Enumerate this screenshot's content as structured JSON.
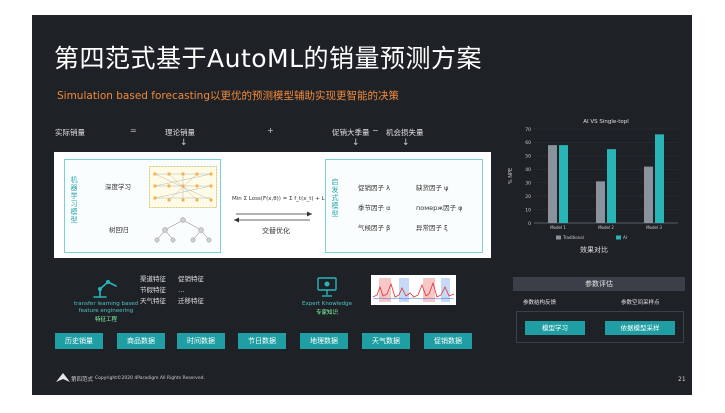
{
  "title": "第四范式基于AutoML的销量预测方案",
  "subtitle": "Simulation based forecasting以更优的预测模型辅助实现更智能的决策",
  "formula_row": {
    "actual": "实际销量",
    "eq": "=",
    "theoretical": "理论销量",
    "plus": "+",
    "promo": "促销大季量",
    "minus": "−",
    "lost": "机会损失量"
  },
  "left_box": {
    "label": "机器学习模型",
    "item1": "深度学习",
    "item2": "树回归"
  },
  "middle": {
    "formula": "Min Σ Loss(F(x,θ)) = Σ f_t(x_t) + L(θ)",
    "caption": "交替优化"
  },
  "right_box": {
    "label": "启发式模型",
    "factors": [
      [
        "促销因子 λ",
        "缺货因子 ψ"
      ],
      [
        "季节因子 α",
        "померж因子 φ"
      ],
      [
        "气候因子 β",
        "异常因子 ξ"
      ]
    ]
  },
  "bottom_left": {
    "caption_en1": "transfer learning based",
    "caption_en2": "feature engineering",
    "caption_cn": "特征工程",
    "features_col1": [
      "渠道特征",
      "节假特征",
      "天气特征"
    ],
    "features_col2": [
      "促销特征",
      "…",
      "迁移特征"
    ]
  },
  "expert": {
    "caption_en": "Expert Knowledge",
    "caption_cn": "专家知识"
  },
  "data_sources": [
    "历史销量",
    "商品数据",
    "时间数据",
    "节日数据",
    "地理数据",
    "天气数据",
    "促销数据"
  ],
  "right_chart": {
    "caption": "效果对比"
  },
  "chart_data": {
    "type": "bar",
    "title": "AI VS Single-topl",
    "categories": [
      "Model 1",
      "Model 2",
      "Model 3"
    ],
    "series": [
      {
        "name": "Traditional",
        "values": [
          58,
          31,
          42
        ]
      },
      {
        "name": "AI",
        "values": [
          58,
          55,
          66
        ]
      }
    ],
    "ylabel": "% NPE",
    "ylim": [
      0,
      70
    ],
    "yticks": [
      0,
      10,
      20,
      30,
      40,
      50,
      60,
      70
    ],
    "legend": "bottom",
    "colors": {
      "Traditional": "#8a929b",
      "AI": "#29b5b8"
    }
  },
  "param_panel": {
    "head": "参数评估",
    "left_label": "参数结构反馈",
    "right_label": "参数空间采样点",
    "btn1": "模型学习",
    "btn2": "依据模型采样"
  },
  "footer": {
    "brand": "第四范式",
    "copyright": "Copyright©2020 4Paradigm All Rights Reserved.",
    "page": "21"
  },
  "colors": {
    "accent": "#1f9fa4",
    "orange": "#f08a3c",
    "background": "#1e2126"
  }
}
